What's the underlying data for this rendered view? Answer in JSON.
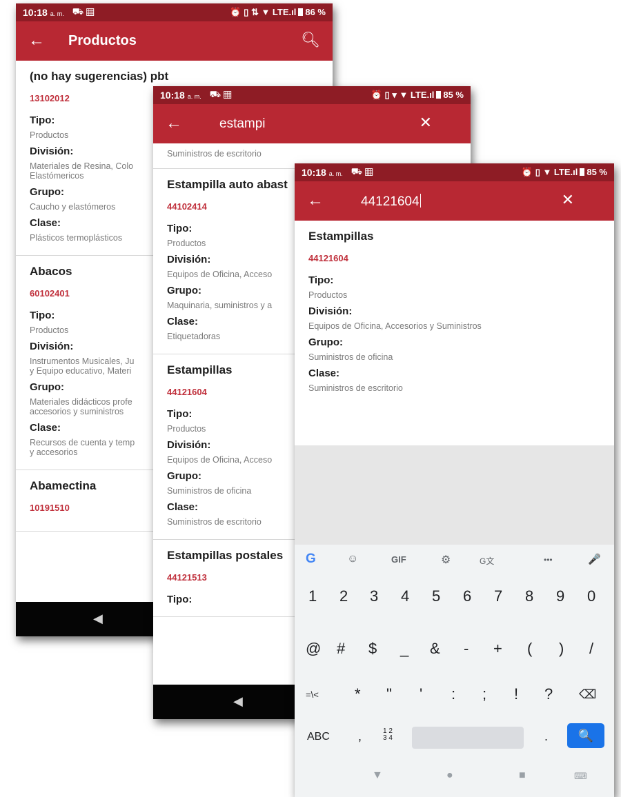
{
  "status": {
    "time": "10:18",
    "ampm": "a. m.",
    "s1_right": "⏰ ▯ ⇅ ▼ LTE.ıl",
    "s1_battery": "86 %",
    "s2_right": "⏰ ▯ ▾ ▼ LTE.ıl",
    "s2_battery": "85 %",
    "s3_right": "⏰ ▯ ▼ LTE.ıl",
    "s3_battery": "85 %"
  },
  "screen1": {
    "title": "Productos",
    "items": [
      {
        "name": "(no hay sugerencias) pbt",
        "code": "13102012",
        "tipo": "Productos",
        "division": "Materiales de Resina, Colo\nElastómericos",
        "grupo": "Caucho y elastómeros",
        "clase": "Plásticos termoplásticos"
      },
      {
        "name": "Abacos",
        "code": "60102401",
        "tipo": "Productos",
        "division": "Instrumentos Musicales, Ju\ny Equipo educativo, Materi",
        "grupo": "Materiales didácticos profe\naccesorios y suministros",
        "clase": "Recursos de cuenta y temp\ny accesorios"
      },
      {
        "name": "Abamectina",
        "code": "10191510"
      }
    ]
  },
  "screen2": {
    "query": "estampi",
    "partial_top": "Suministros de escritorio",
    "items": [
      {
        "name": "Estampilla auto abast",
        "code": "44102414",
        "tipo": "Productos",
        "division": "Equipos de Oficina, Acceso",
        "grupo": "Maquinaria, suministros y a",
        "clase": "Etiquetadoras"
      },
      {
        "name": "Estampillas",
        "code": "44121604",
        "tipo": "Productos",
        "division": "Equipos de Oficina, Acceso",
        "grupo": "Suministros de oficina",
        "clase": "Suministros de escritorio"
      },
      {
        "name": "Estampillas postales",
        "code": "44121513",
        "tipo_partial": "Tipo:"
      }
    ]
  },
  "screen3": {
    "query": "44121604",
    "item": {
      "name": "Estampillas",
      "code": "44121604",
      "tipo": "Productos",
      "division": "Equipos de Oficina, Accesorios y Suministros",
      "grupo": "Suministros de oficina",
      "clase": "Suministros de escritorio"
    }
  },
  "labels": {
    "tipo": "Tipo:",
    "division": "División:",
    "grupo": "Grupo:",
    "clase": "Clase:"
  },
  "keyboard": {
    "toolbar": {
      "google": "G",
      "sticker": "☺",
      "gif": "GIF",
      "settings": "⚙",
      "translate": "G文",
      "more": "•••",
      "mic": "🎤"
    },
    "row1": [
      "1",
      "2",
      "3",
      "4",
      "5",
      "6",
      "7",
      "8",
      "9",
      "0"
    ],
    "row2": [
      "@",
      "#",
      "$",
      "_",
      "&",
      "-",
      "+",
      "(",
      ")",
      "/"
    ],
    "row3": [
      "=\\<",
      "*",
      "\"",
      "'",
      ":",
      ";",
      "!",
      "?",
      "⌫"
    ],
    "row4": {
      "abc": "ABC",
      "comma": ",",
      "numpad": "1 2\n3 4",
      "period": ".",
      "search": "🔍"
    },
    "nav": {
      "back": "▼",
      "home": "●",
      "recents": "■",
      "keyboard": "⌨"
    }
  },
  "navbar": {
    "back": "◀"
  },
  "colors": {
    "appbar": "#b82833",
    "statusbar": "#8e1c25",
    "code": "#c0303c",
    "search_key": "#1a73e8"
  }
}
